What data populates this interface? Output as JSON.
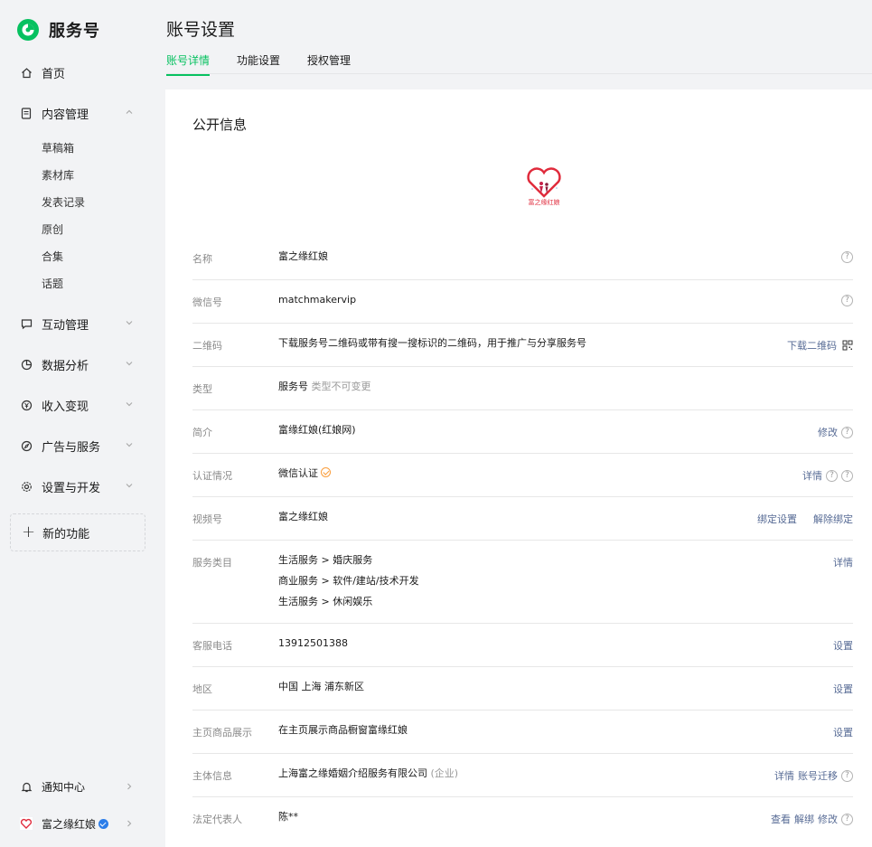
{
  "app": {
    "brand": "服务号"
  },
  "nav": {
    "home": "首页",
    "content": {
      "label": "内容管理",
      "subs": [
        "草稿箱",
        "素材库",
        "发表记录",
        "原创",
        "合集",
        "话题"
      ]
    },
    "interact": "互动管理",
    "analytics": "数据分析",
    "revenue": "收入变现",
    "ads": "广告与服务",
    "settings": "设置与开发",
    "new_feature": "新的功能",
    "notifications": "通知中心",
    "account": "富之缘红娘"
  },
  "header": {
    "title": "账号设置",
    "tabs": [
      "账号详情",
      "功能设置",
      "授权管理"
    ]
  },
  "public_info": {
    "title": "公开信息",
    "rows": {
      "name": {
        "label": "名称",
        "value": "富之缘红娘"
      },
      "wechat_id": {
        "label": "微信号",
        "value": "matchmakervip"
      },
      "qrcode": {
        "label": "二维码",
        "value": "下载服务号二维码或带有搜一搜标识的二维码，用于推广与分享服务号",
        "action": "下载二维码"
      },
      "type": {
        "label": "类型",
        "value": "服务号",
        "note": "类型不可变更"
      },
      "intro": {
        "label": "简介",
        "value": "富缘红娘(红娘网)",
        "action": "修改"
      },
      "cert": {
        "label": "认证情况",
        "value": "微信认证",
        "action": "详情"
      },
      "channels": {
        "label": "视频号",
        "value": "富之缘红娘",
        "action1": "绑定设置",
        "action2": "解除绑定"
      },
      "category": {
        "label": "服务类目",
        "lines": [
          "生活服务 > 婚庆服务",
          "商业服务 > 软件/建站/技术开发",
          "生活服务 > 休闲娱乐"
        ],
        "action": "详情"
      },
      "phone": {
        "label": "客服电话",
        "value": "13912501388",
        "action": "设置"
      },
      "region": {
        "label": "地区",
        "value": "中国 上海 浦东新区",
        "action": "设置"
      },
      "shop": {
        "label": "主页商品展示",
        "value": "在主页展示商品橱窗富缘红娘",
        "action": "设置"
      },
      "entity": {
        "label": "主体信息",
        "value": "上海富之缘婚姻介绍服务有限公司",
        "note": "(企业)",
        "action1": "详情",
        "action2": "账号迁移"
      },
      "legal": {
        "label": "法定代表人",
        "value": "陈**",
        "action1": "查看",
        "action2": "解绑",
        "action3": "修改"
      }
    },
    "help_glyph": "?"
  },
  "avatar_text": "富之缘红娘",
  "colors": {
    "accent": "#07c160",
    "link": "#576b95",
    "warn": "#fa9d3b",
    "verified": "#2b7de9"
  }
}
